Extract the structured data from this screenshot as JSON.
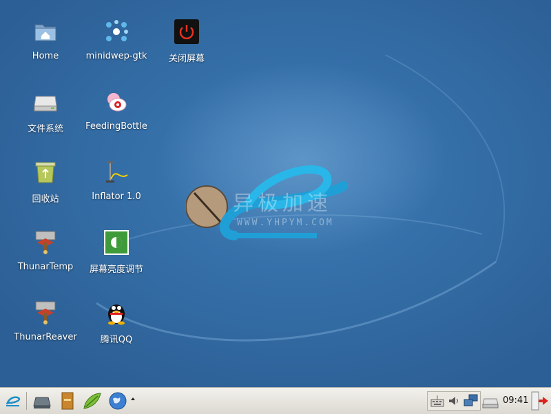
{
  "desktop": {
    "icons": [
      {
        "label": "Home",
        "icon": "home-folder-icon"
      },
      {
        "label": "minidwep-gtk",
        "icon": "minidwep-icon"
      },
      {
        "label": "关闭屏幕",
        "icon": "power-icon"
      },
      {
        "label": "文件系统",
        "icon": "drive-icon"
      },
      {
        "label": "FeedingBottle",
        "icon": "feeding-bottle-icon"
      },
      {
        "label": "回收站",
        "icon": "trash-icon"
      },
      {
        "label": "Inflator 1.0",
        "icon": "inflator-icon"
      },
      {
        "label": "ThunarTemp",
        "icon": "thunar-temp-icon"
      },
      {
        "label": "屏幕亮度调节",
        "icon": "brightness-icon"
      },
      {
        "label": "ThunarReaver",
        "icon": "thunar-reaver-icon"
      },
      {
        "label": "腾讯QQ",
        "icon": "qq-penguin-icon"
      }
    ],
    "watermark": {
      "title": "异极加速",
      "url": "WWW.YHPYM.COM"
    }
  },
  "taskbar": {
    "launchers": [
      "start-menu-icon",
      "show-desktop-icon",
      "file-manager-icon",
      "text-editor-icon",
      "web-browser-icon"
    ],
    "tray_icons": [
      "keyboard-icon",
      "volume-icon",
      "network-icon"
    ],
    "clock": "09:41"
  },
  "colors": {
    "desktop_bg": "#356fa8",
    "taskbar_bg": "#e8e5de",
    "logo_cyan": "#29b6e8",
    "label_text": "#ffffff"
  }
}
